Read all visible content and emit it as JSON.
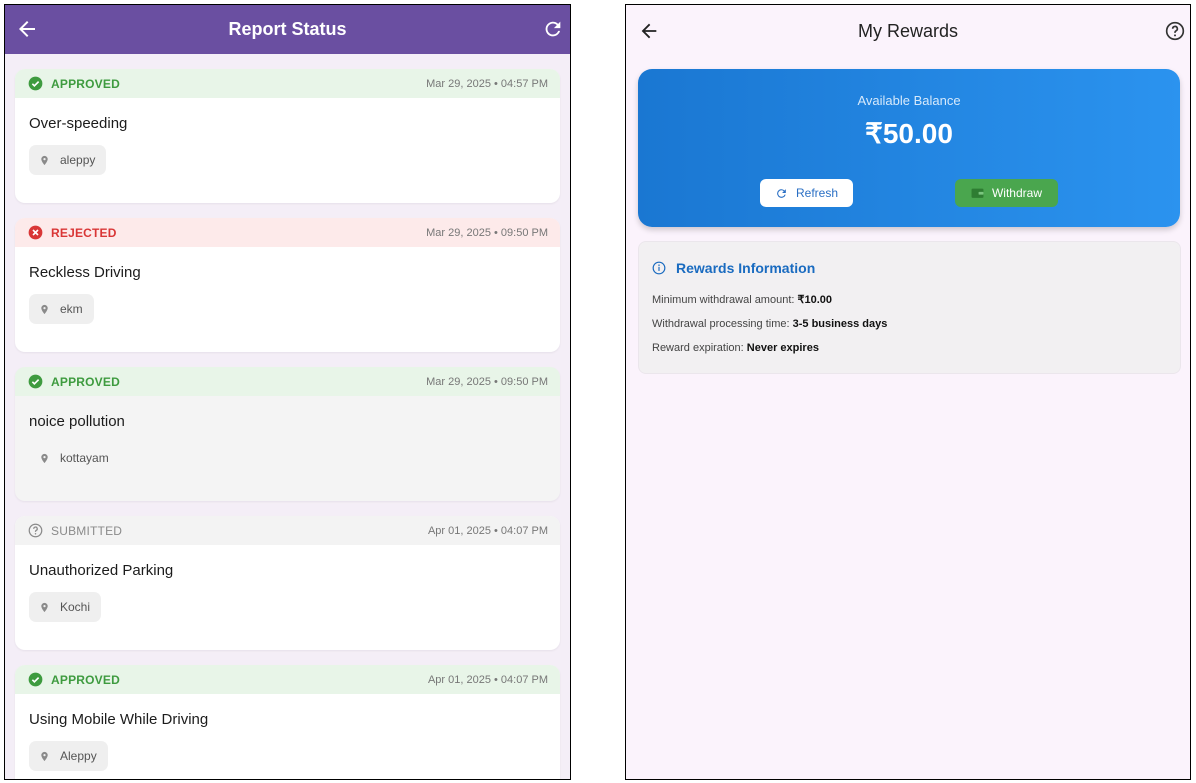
{
  "report_screen": {
    "title": "Report Status",
    "reports": [
      {
        "status": "APPROVED",
        "status_type": "approved",
        "date": "Mar 29, 2025 • 04:57 PM",
        "title": "Over-speeding",
        "location": "aleppy"
      },
      {
        "status": "REJECTED",
        "status_type": "rejected",
        "date": "Mar 29, 2025 • 09:50 PM",
        "title": "Reckless Driving",
        "location": "ekm"
      },
      {
        "status": "APPROVED",
        "status_type": "approved",
        "date": "Mar 29, 2025 • 09:50 PM",
        "title": "noice pollution",
        "location": "kottayam"
      },
      {
        "status": "SUBMITTED",
        "status_type": "submitted",
        "date": "Apr 01, 2025 • 04:07 PM",
        "title": "Unauthorized Parking",
        "location": "Kochi"
      },
      {
        "status": "APPROVED",
        "status_type": "approved",
        "date": "Apr 01, 2025 • 04:07 PM",
        "title": "Using Mobile While Driving",
        "location": "Aleppy"
      }
    ]
  },
  "rewards_screen": {
    "title": "My Rewards",
    "balance_label": "Available Balance",
    "balance": "₹50.00",
    "refresh_label": "Refresh",
    "withdraw_label": "Withdraw",
    "info": {
      "title": "Rewards Information",
      "min_label": "Minimum withdrawal amount: ",
      "min_value": "₹10.00",
      "time_label": "Withdrawal processing time: ",
      "time_value": "3-5 business days",
      "expiry_label": "Reward expiration: ",
      "expiry_value": "Never expires"
    }
  },
  "colors": {
    "appbar": "#6a4fa1",
    "approved": "#3e9b3f",
    "rejected": "#d93636",
    "submitted": "#8a8a8a",
    "balance_gradient_start": "#1a77d2",
    "balance_gradient_end": "#2b93ef",
    "withdraw": "#4aa64e"
  },
  "icons": {
    "back": "arrow-left-icon",
    "refresh": "refresh-icon",
    "help": "help-circle-icon",
    "approved": "check-circle-icon",
    "rejected": "x-circle-icon",
    "submitted": "question-circle-icon",
    "location": "location-pin-icon",
    "wallet": "wallet-icon",
    "info": "info-icon"
  }
}
